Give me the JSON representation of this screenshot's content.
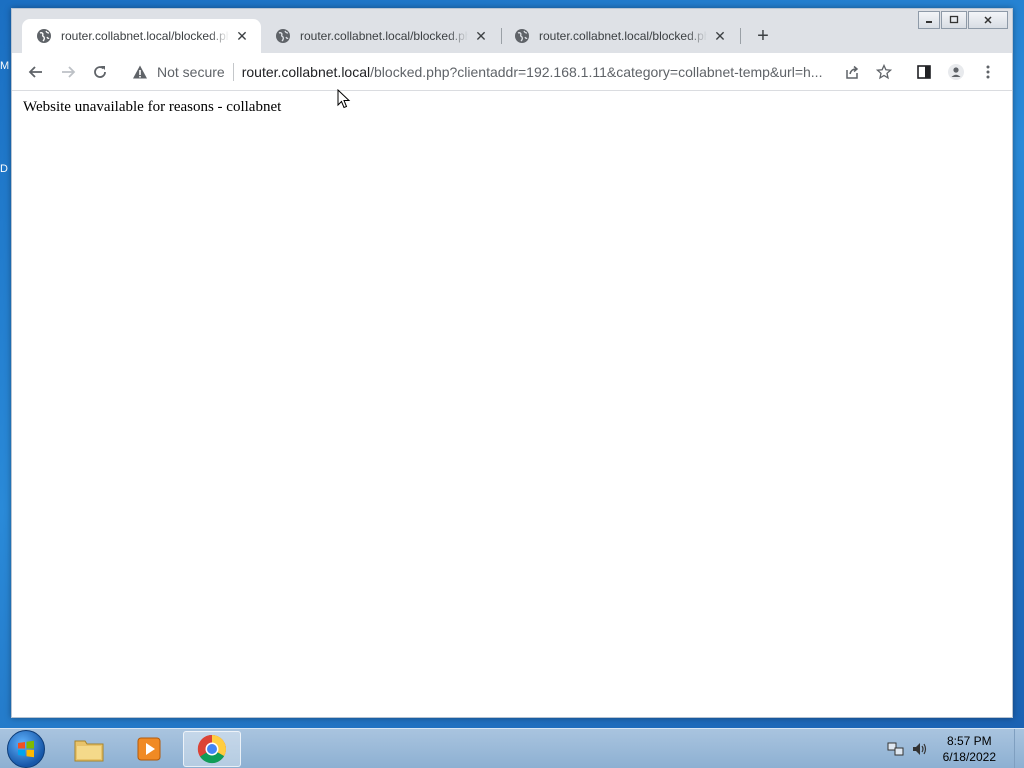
{
  "browser": {
    "tabs": [
      {
        "title": "router.collabnet.local/blocked.php"
      },
      {
        "title": "router.collabnet.local/blocked.php"
      },
      {
        "title": "router.collabnet.local/blocked.php"
      }
    ],
    "security_label": "Not secure",
    "url_host": "router.collabnet.local",
    "url_path": "/blocked.php?clientaddr=192.168.1.11&category=collabnet-temp&url=h..."
  },
  "page": {
    "message": "Website unavailable for reasons - collabnet"
  },
  "taskbar": {
    "time": "8:57 PM",
    "date": "6/18/2022"
  },
  "colors": {
    "tabstrip": "#dee1e6",
    "taskbar": "#a9c4df",
    "desktop": "#1b6fc2"
  }
}
